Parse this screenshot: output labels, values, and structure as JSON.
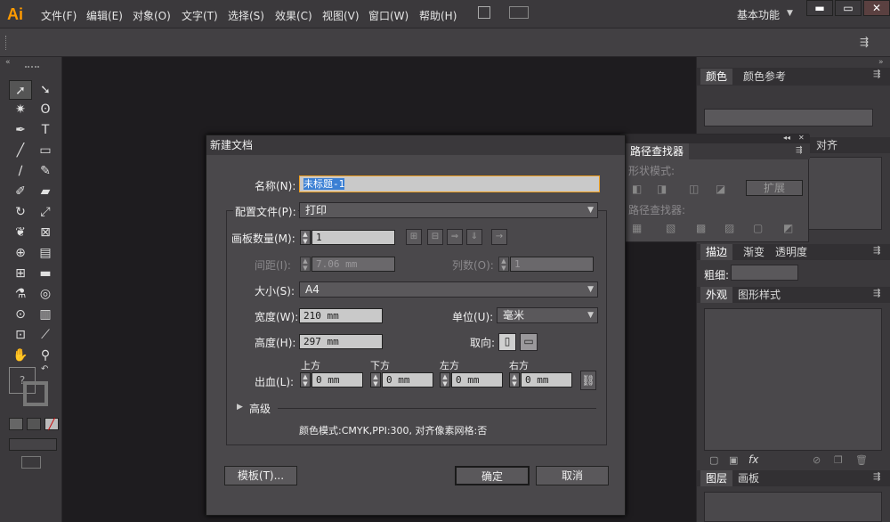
{
  "app": {
    "logo": "Ai",
    "workspace": "基本功能"
  },
  "menu": [
    "文件(F)",
    "编辑(E)",
    "对象(O)",
    "文字(T)",
    "选择(S)",
    "效果(C)",
    "视图(V)",
    "窗口(W)",
    "帮助(H)"
  ],
  "window_controls": {
    "minimize": "▬",
    "maximize": "▭",
    "close": "✕"
  },
  "panels": {
    "color_tabs": [
      "颜色",
      "颜色参考"
    ],
    "pathfinder_title": "路径查找器",
    "align_tab": "对齐",
    "shape_modes": "形状模式:",
    "expand_button": "扩展",
    "pathfinders": "路径查找器:",
    "stroke_tabs": [
      "描边",
      "渐变",
      "透明度"
    ],
    "stroke_weight_label": "粗细:",
    "appearance_tabs": [
      "外观",
      "图形样式"
    ],
    "layers_tabs": [
      "图层",
      "画板"
    ]
  },
  "dialog": {
    "title": "新建文档",
    "name_label": "名称(N):",
    "name_value": "未标题-1",
    "profile_label": "配置文件(P):",
    "profile_value": "打印",
    "artboards_label": "画板数量(M):",
    "artboards_value": "1",
    "spacing_label": "间距(I):",
    "spacing_value": "7.06 mm",
    "columns_label": "列数(O):",
    "columns_value": "1",
    "size_label": "大小(S):",
    "size_value": "A4",
    "width_label": "宽度(W):",
    "width_value": "210 mm",
    "units_label": "单位(U):",
    "units_value": "毫米",
    "height_label": "高度(H):",
    "height_value": "297 mm",
    "orientation_label": "取向:",
    "bleed_label": "出血(L):",
    "bleed_top_label": "上方",
    "bleed_bottom_label": "下方",
    "bleed_left_label": "左方",
    "bleed_right_label": "右方",
    "bleed_top": "0 mm",
    "bleed_bottom": "0 mm",
    "bleed_left": "0 mm",
    "bleed_right": "0 mm",
    "advanced_label": "高级",
    "color_mode_info": "颜色模式:CMYK,PPI:300, 对齐像素网格:否",
    "templates_button": "模板(T)...",
    "ok_button": "确定",
    "cancel_button": "取消"
  }
}
